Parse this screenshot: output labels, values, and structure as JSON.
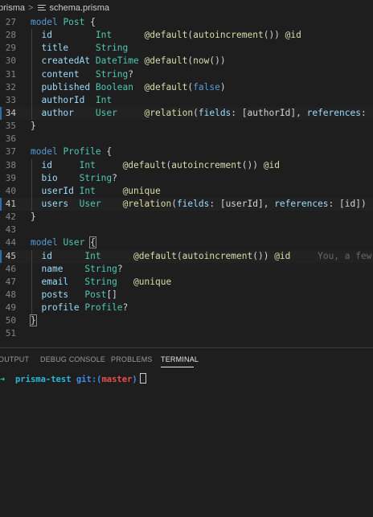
{
  "breadcrumb": {
    "folder": "prisma",
    "separator": ">",
    "file": "schema.prisma"
  },
  "editor": {
    "lines": [
      {
        "n": "27",
        "parts": [
          [
            "kw",
            "model"
          ],
          [
            "p",
            " "
          ],
          [
            "model",
            "Post"
          ],
          [
            "p",
            " {"
          ]
        ]
      },
      {
        "n": "28",
        "guide": true,
        "parts": [
          [
            "p",
            "  "
          ],
          [
            "field",
            "id"
          ],
          [
            "p",
            "        "
          ],
          [
            "type",
            "Int"
          ],
          [
            "p",
            "      "
          ],
          [
            "attr",
            "@default"
          ],
          [
            "p",
            "("
          ],
          [
            "fn",
            "autoincrement"
          ],
          [
            "p",
            "()) "
          ],
          [
            "attr",
            "@id"
          ]
        ]
      },
      {
        "n": "29",
        "guide": true,
        "parts": [
          [
            "p",
            "  "
          ],
          [
            "field",
            "title"
          ],
          [
            "p",
            "     "
          ],
          [
            "type",
            "String"
          ]
        ]
      },
      {
        "n": "30",
        "guide": true,
        "parts": [
          [
            "p",
            "  "
          ],
          [
            "field",
            "createdAt"
          ],
          [
            "p",
            " "
          ],
          [
            "type",
            "DateTime"
          ],
          [
            "p",
            " "
          ],
          [
            "attr",
            "@default"
          ],
          [
            "p",
            "("
          ],
          [
            "fn",
            "now"
          ],
          [
            "p",
            "())"
          ]
        ]
      },
      {
        "n": "31",
        "guide": true,
        "parts": [
          [
            "p",
            "  "
          ],
          [
            "field",
            "content"
          ],
          [
            "p",
            "   "
          ],
          [
            "type",
            "String"
          ],
          [
            "p",
            "?"
          ]
        ]
      },
      {
        "n": "32",
        "guide": true,
        "parts": [
          [
            "p",
            "  "
          ],
          [
            "field",
            "published"
          ],
          [
            "p",
            " "
          ],
          [
            "type",
            "Boolean"
          ],
          [
            "p",
            "  "
          ],
          [
            "attr",
            "@default"
          ],
          [
            "p",
            "("
          ],
          [
            "bool",
            "false"
          ],
          [
            "p",
            ")"
          ]
        ]
      },
      {
        "n": "33",
        "guide": true,
        "parts": [
          [
            "p",
            "  "
          ],
          [
            "field",
            "authorId"
          ],
          [
            "p",
            "  "
          ],
          [
            "type",
            "Int"
          ]
        ]
      },
      {
        "n": "34",
        "guide": true,
        "active": true,
        "parts": [
          [
            "p",
            "  "
          ],
          [
            "field",
            "author"
          ],
          [
            "p",
            "    "
          ],
          [
            "type",
            "User"
          ],
          [
            "p",
            "     "
          ],
          [
            "attr",
            "@relation"
          ],
          [
            "p",
            "("
          ],
          [
            "field",
            "fields"
          ],
          [
            "p",
            ": [authorId], "
          ],
          [
            "field",
            "references"
          ],
          [
            "p",
            ": [id])"
          ]
        ]
      },
      {
        "n": "35",
        "parts": [
          [
            "p",
            "}"
          ]
        ]
      },
      {
        "n": "36",
        "parts": []
      },
      {
        "n": "37",
        "parts": [
          [
            "kw",
            "model"
          ],
          [
            "p",
            " "
          ],
          [
            "model",
            "Profile"
          ],
          [
            "p",
            " {"
          ]
        ]
      },
      {
        "n": "38",
        "guide": true,
        "parts": [
          [
            "p",
            "  "
          ],
          [
            "field",
            "id"
          ],
          [
            "p",
            "     "
          ],
          [
            "type",
            "Int"
          ],
          [
            "p",
            "     "
          ],
          [
            "attr",
            "@default"
          ],
          [
            "p",
            "("
          ],
          [
            "fn",
            "autoincrement"
          ],
          [
            "p",
            "()) "
          ],
          [
            "attr",
            "@id"
          ]
        ]
      },
      {
        "n": "39",
        "guide": true,
        "parts": [
          [
            "p",
            "  "
          ],
          [
            "field",
            "bio"
          ],
          [
            "p",
            "    "
          ],
          [
            "type",
            "String"
          ],
          [
            "p",
            "?"
          ]
        ]
      },
      {
        "n": "40",
        "guide": true,
        "parts": [
          [
            "p",
            "  "
          ],
          [
            "field",
            "userId"
          ],
          [
            "p",
            " "
          ],
          [
            "type",
            "Int"
          ],
          [
            "p",
            "     "
          ],
          [
            "attr",
            "@unique"
          ]
        ]
      },
      {
        "n": "41",
        "guide": true,
        "active": true,
        "parts": [
          [
            "p",
            "  "
          ],
          [
            "field",
            "users"
          ],
          [
            "p",
            "  "
          ],
          [
            "type",
            "User"
          ],
          [
            "p",
            "    "
          ],
          [
            "attr",
            "@relation"
          ],
          [
            "p",
            "("
          ],
          [
            "field",
            "fields"
          ],
          [
            "p",
            ": [userId], "
          ],
          [
            "field",
            "references"
          ],
          [
            "p",
            ": [id])"
          ]
        ]
      },
      {
        "n": "42",
        "parts": [
          [
            "p",
            "}"
          ]
        ]
      },
      {
        "n": "43",
        "parts": []
      },
      {
        "n": "44",
        "parts": [
          [
            "kw",
            "model"
          ],
          [
            "p",
            " "
          ],
          [
            "model",
            "User"
          ],
          [
            "p",
            " "
          ],
          [
            "brace",
            "{"
          ]
        ]
      },
      {
        "n": "45",
        "guide": true,
        "active": true,
        "parts": [
          [
            "p",
            "  "
          ],
          [
            "field",
            "id"
          ],
          [
            "p",
            "      "
          ],
          [
            "type",
            "Int"
          ],
          [
            "p",
            "      "
          ],
          [
            "attr",
            "@default"
          ],
          [
            "p",
            "("
          ],
          [
            "fn",
            "autoincrement"
          ],
          [
            "p",
            "()) "
          ],
          [
            "attr",
            "@id"
          ],
          [
            "p",
            "     "
          ],
          [
            "ghost",
            "You, a few s"
          ]
        ]
      },
      {
        "n": "46",
        "guide": true,
        "parts": [
          [
            "p",
            "  "
          ],
          [
            "field",
            "name"
          ],
          [
            "p",
            "    "
          ],
          [
            "type",
            "String"
          ],
          [
            "p",
            "?"
          ]
        ]
      },
      {
        "n": "47",
        "guide": true,
        "parts": [
          [
            "p",
            "  "
          ],
          [
            "field",
            "email"
          ],
          [
            "p",
            "   "
          ],
          [
            "type",
            "String"
          ],
          [
            "p",
            "   "
          ],
          [
            "attr",
            "@unique"
          ]
        ]
      },
      {
        "n": "48",
        "guide": true,
        "parts": [
          [
            "p",
            "  "
          ],
          [
            "field",
            "posts"
          ],
          [
            "p",
            "   "
          ],
          [
            "type",
            "Post"
          ],
          [
            "p",
            "[]"
          ]
        ]
      },
      {
        "n": "49",
        "guide": true,
        "parts": [
          [
            "p",
            "  "
          ],
          [
            "field",
            "profile"
          ],
          [
            "p",
            " "
          ],
          [
            "type",
            "Profile"
          ],
          [
            "p",
            "?"
          ]
        ]
      },
      {
        "n": "50",
        "parts": [
          [
            "brace",
            "}"
          ]
        ]
      },
      {
        "n": "51",
        "parts": []
      }
    ]
  },
  "panel": {
    "tabs": [
      "OUTPUT",
      "DEBUG CONSOLE",
      "PROBLEMS",
      "TERMINAL"
    ],
    "active_tab": "TERMINAL"
  },
  "terminal": {
    "arrow": "➜",
    "dir": "prisma-test",
    "git_label": "git:(",
    "branch": "master",
    "git_close": ")"
  },
  "colors": {
    "background": "#1e1e1e",
    "keyword": "#569cd6",
    "type": "#4ec9b0",
    "field": "#9cdcfe",
    "attribute": "#dcdcaa",
    "line_change_bar": "#2d6ea8"
  },
  "icons": {
    "file": "list-lines-icon",
    "cursor": "terminal-block-cursor-icon"
  }
}
